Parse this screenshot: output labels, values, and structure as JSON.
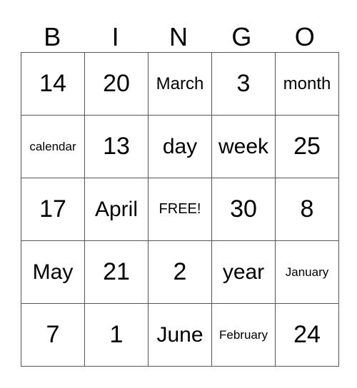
{
  "header": [
    "B",
    "I",
    "N",
    "G",
    "O"
  ],
  "rows": [
    [
      "14",
      "20",
      "March",
      "3",
      "month"
    ],
    [
      "calendar",
      "13",
      "day",
      "week",
      "25"
    ],
    [
      "17",
      "April",
      "FREE!",
      "30",
      "8"
    ],
    [
      "May",
      "21",
      "2",
      "year",
      "January"
    ],
    [
      "7",
      "1",
      "June",
      "February",
      "24"
    ]
  ]
}
